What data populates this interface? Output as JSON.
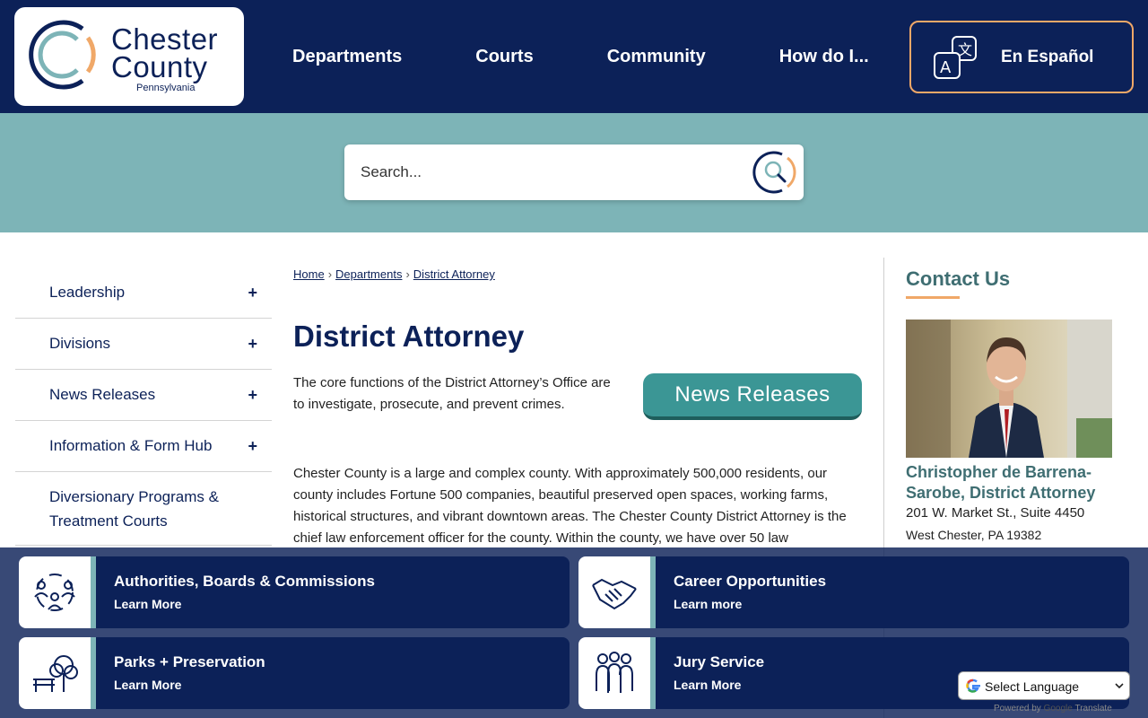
{
  "logo": {
    "line1": "Chester",
    "line2": "County",
    "state": "Pennsylvania"
  },
  "nav": {
    "items": [
      "Departments",
      "Courts",
      "Community",
      "How do I..."
    ]
  },
  "spanish_button": {
    "label": "En Español"
  },
  "search": {
    "placeholder": "Search..."
  },
  "sidebar": {
    "items": [
      {
        "label": "Leadership",
        "expand": "+"
      },
      {
        "label": "Divisions",
        "expand": "+"
      },
      {
        "label": "News Releases",
        "expand": "+"
      },
      {
        "label": "Information & Form Hub",
        "expand": "+"
      },
      {
        "label": "Diversionary Programs & Treatment Courts"
      }
    ]
  },
  "breadcrumb": {
    "home": "Home",
    "departments": "Departments",
    "current": "District Attorney",
    "separator": "›"
  },
  "main": {
    "title": "District Attorney",
    "intro": "The core functions of the District Attorney’s Office are to investigate, prosecute, and prevent crimes.",
    "news_button": "News Releases",
    "body": "Chester County is a large and complex county. With approximately 500,000 residents, our county includes Fortune 500 companies, beautiful preserved open spaces, working farms, historical structures, and vibrant downtown areas. The Chester County District Attorney is the chief law enforcement officer for the county. Within the county, we have over 50 law"
  },
  "contact": {
    "title": "Contact Us",
    "name": "Christopher de Barrena-Sarobe, District Attorney",
    "address1": "201 W. Market St., Suite 4450",
    "address2": "West Chester, PA 19382"
  },
  "cards": [
    {
      "title": "Authorities, Boards & Commissions",
      "subtitle": "Learn More",
      "icon": "people-network-icon"
    },
    {
      "title": "Career Opportunities",
      "subtitle": "Learn more",
      "icon": "handshake-icon"
    },
    {
      "title": "Parks + Preservation",
      "subtitle": "Learn More",
      "icon": "park-bench-tree-icon"
    },
    {
      "title": "Jury Service",
      "subtitle": "Learn More",
      "icon": "jury-group-icon"
    }
  ],
  "language_select": {
    "label": "Select Language",
    "powered_prefix": "Powered by",
    "powered_brand": "Google",
    "powered_suffix": "Translate"
  },
  "colors": {
    "navy": "#0c2158",
    "teal": "#7db4b7",
    "orange": "#f0a868",
    "button_teal": "#3b9695"
  }
}
